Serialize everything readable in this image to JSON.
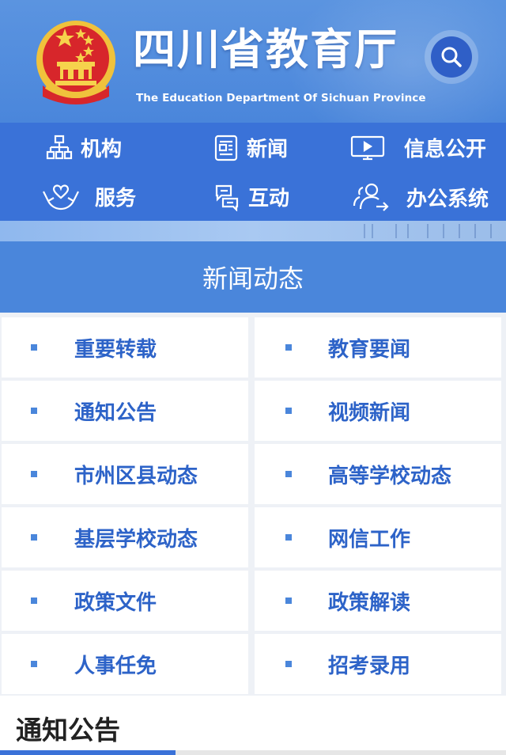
{
  "header": {
    "title": "四川省教育厅",
    "subtitle": "The Education Department Of Sichuan Province"
  },
  "nav": {
    "items": [
      {
        "label": "机构",
        "icon": "org-chart-icon"
      },
      {
        "label": "新闻",
        "icon": "news-icon"
      },
      {
        "label": "信息公开",
        "icon": "monitor-icon"
      },
      {
        "label": "服务",
        "icon": "heart-hands-icon"
      },
      {
        "label": "互动",
        "icon": "chat-icon"
      },
      {
        "label": "办公系统",
        "icon": "users-arrow-icon"
      }
    ]
  },
  "section": {
    "title": "新闻动态"
  },
  "categories": [
    [
      "重要转载",
      "教育要闻"
    ],
    [
      "通知公告",
      "视频新闻"
    ],
    [
      "市州区县动态",
      "高等学校动态"
    ],
    [
      "基层学校动态",
      "网信工作"
    ],
    [
      "政策文件",
      "政策解读"
    ],
    [
      "人事任免",
      "招考录用"
    ]
  ],
  "notice": {
    "title": "通知公告"
  },
  "colors": {
    "primary": "#3a72d8",
    "header": "#4a86db",
    "link": "#2d63c8",
    "emblem_red": "#d7262b",
    "emblem_gold": "#f0c23c"
  }
}
